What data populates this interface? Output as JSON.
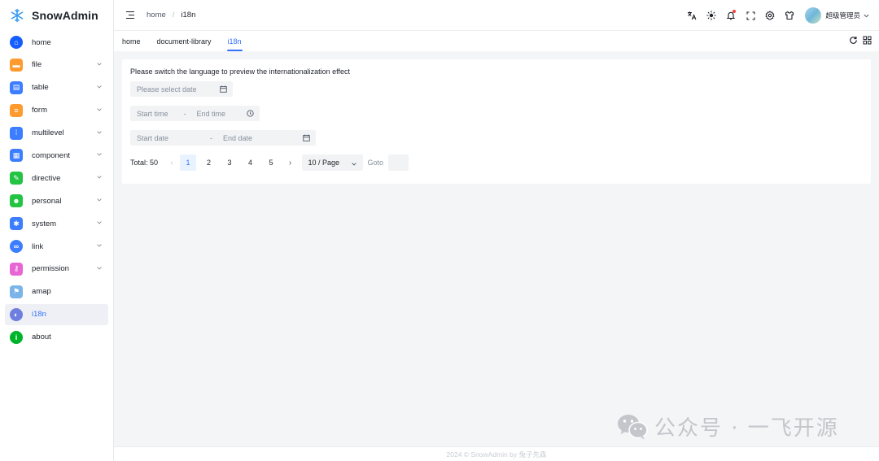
{
  "app": {
    "title": "SnowAdmin"
  },
  "sidebar": {
    "items": [
      {
        "label": "home",
        "color": "#165dff",
        "round": true,
        "glyph": "⌂",
        "chevron": false
      },
      {
        "label": "file",
        "color": "#ff9a2e",
        "round": false,
        "glyph": "▬",
        "chevron": true
      },
      {
        "label": "table",
        "color": "#3c7eff",
        "round": false,
        "glyph": "▤",
        "chevron": true
      },
      {
        "label": "form",
        "color": "#ff9a2e",
        "round": false,
        "glyph": "≡",
        "chevron": true
      },
      {
        "label": "multilevel",
        "color": "#3c7eff",
        "round": false,
        "glyph": "⫶",
        "chevron": true
      },
      {
        "label": "component",
        "color": "#3c7eff",
        "round": false,
        "glyph": "▦",
        "chevron": true
      },
      {
        "label": "directive",
        "color": "#23c343",
        "round": false,
        "glyph": "✎",
        "chevron": true
      },
      {
        "label": "personal",
        "color": "#23c343",
        "round": false,
        "glyph": "☻",
        "chevron": true
      },
      {
        "label": "system",
        "color": "#3c7eff",
        "round": false,
        "glyph": "✱",
        "chevron": true
      },
      {
        "label": "link",
        "color": "#3c7eff",
        "round": true,
        "glyph": "∞",
        "chevron": true
      },
      {
        "label": "permission",
        "color": "#e865d4",
        "round": false,
        "glyph": "⚷",
        "chevron": true
      },
      {
        "label": "amap",
        "color": "#7bb4e8",
        "round": false,
        "glyph": "⚑",
        "chevron": false
      },
      {
        "label": "i18n",
        "color": "#6e7fe0",
        "round": true,
        "glyph": "◐",
        "chevron": false
      },
      {
        "label": "about",
        "color": "#00b42a",
        "round": true,
        "glyph": "i",
        "chevron": false
      }
    ]
  },
  "breadcrumb": {
    "items": [
      "home",
      "i18n"
    ],
    "separator": "/"
  },
  "header": {
    "user_name": "超级管理员"
  },
  "tabs": [
    "home",
    "document-library",
    "i18n"
  ],
  "content": {
    "description": "Please switch the language to preview the internationalization effect",
    "date_placeholder": "Please select date",
    "time_range": {
      "start": "Start time",
      "separator": "-",
      "end": "End time"
    },
    "date_range": {
      "start": "Start date",
      "separator": "-",
      "end": "End date"
    }
  },
  "pagination": {
    "total": "Total: 50",
    "pages": [
      "1",
      "2",
      "3",
      "4",
      "5"
    ],
    "current": "1",
    "page_size": "10 / Page",
    "goto_label": "Goto"
  },
  "footer": {
    "text": "2024 © SnowAdmin by 兔子先森"
  },
  "watermark": {
    "text": "公众号 · 一飞开源"
  },
  "colors": {
    "accent": "#3370ff",
    "active_bg": "#eef0f5"
  }
}
